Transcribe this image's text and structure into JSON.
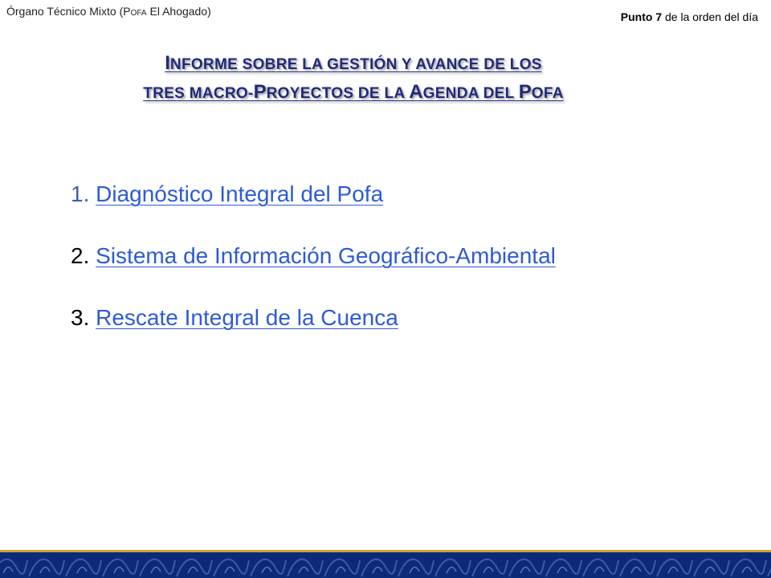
{
  "header": {
    "org_prefix": "Órgano Técnico Mixto (P",
    "org_smallcaps": "OFA",
    "org_suffix": " El Ahogado)",
    "agenda_bold": "Punto 7",
    "agenda_rest": " de la orden del día"
  },
  "title": {
    "line1": [
      {
        "text": "I",
        "size": "big"
      },
      {
        "text": "NFORME SOBRE LA GESTIÓN Y AVANCE DE LOS",
        "size": "small"
      }
    ],
    "line2": [
      {
        "text": "TRES MACRO-",
        "size": "small"
      },
      {
        "text": "P",
        "size": "big"
      },
      {
        "text": "ROYECTOS DE LA ",
        "size": "small"
      },
      {
        "text": "A",
        "size": "big"
      },
      {
        "text": "GENDA DEL ",
        "size": "small"
      },
      {
        "text": "P",
        "size": "big"
      },
      {
        "text": "OFA",
        "size": "small"
      }
    ]
  },
  "items": [
    {
      "number": "1. ",
      "label": "Diagnóstico Integral del Pofa"
    },
    {
      "number": "2. ",
      "label": "Sistema de Información Geográfico-Ambiental"
    },
    {
      "number": "3. ",
      "label": "Rescate Integral de la Cuenca"
    }
  ],
  "colors": {
    "title": "#1f2a7a",
    "link": "#2d5bd6",
    "footer_band": "#0d2a78",
    "footer_gold": "#c9a43a"
  }
}
